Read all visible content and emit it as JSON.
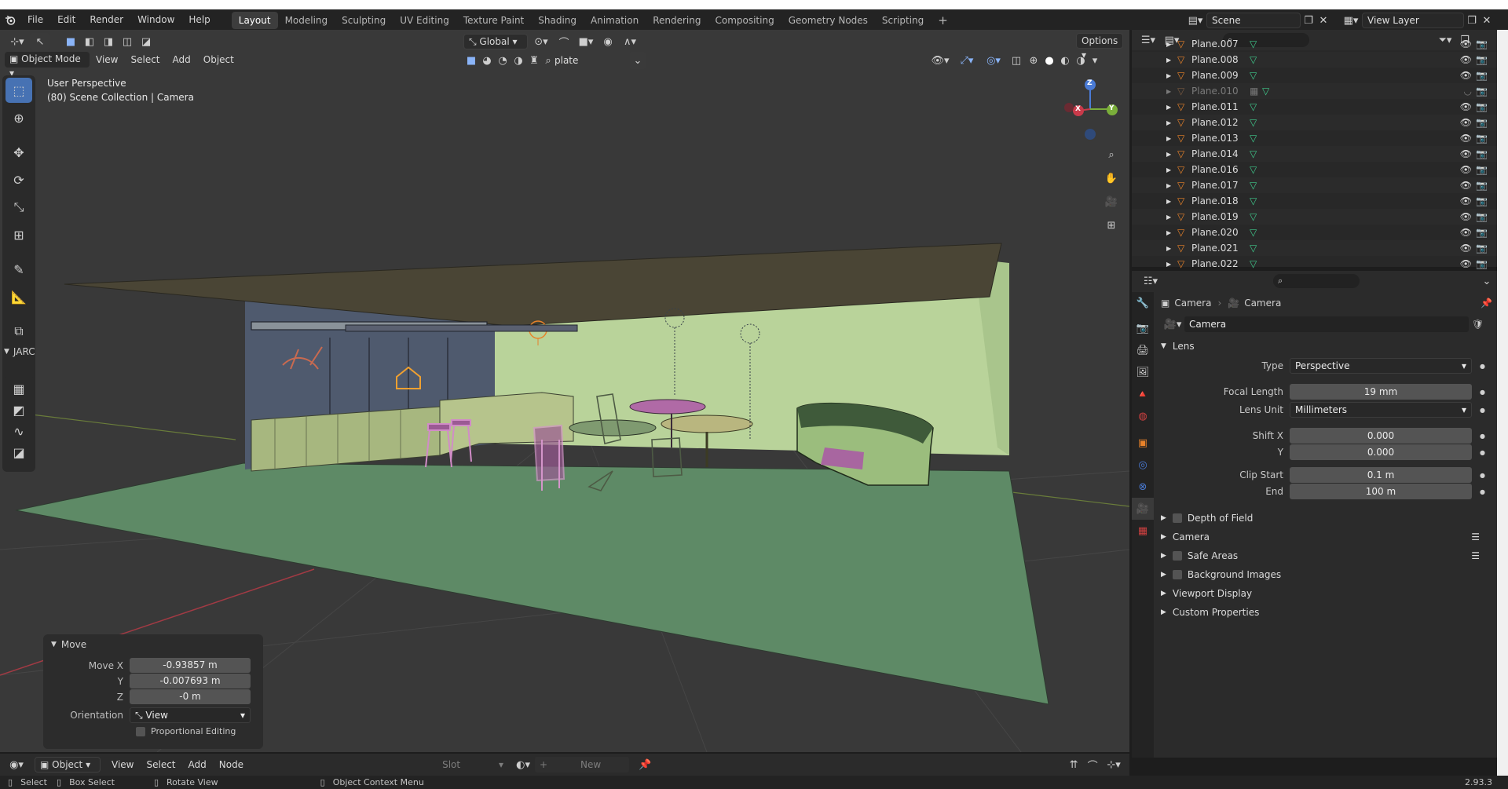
{
  "topbar": {
    "menus": [
      "File",
      "Edit",
      "Render",
      "Window",
      "Help"
    ],
    "workspace_tabs": [
      "Layout",
      "Modeling",
      "Sculpting",
      "UV Editing",
      "Texture Paint",
      "Shading",
      "Animation",
      "Rendering",
      "Compositing",
      "Geometry Nodes",
      "Scripting"
    ],
    "active_tab": "Layout",
    "scene": "Scene",
    "view_layer": "View Layer"
  },
  "viewport_header": {
    "mode": "Object Mode",
    "menus": [
      "View",
      "Select",
      "Add",
      "Object"
    ],
    "orientation": "Global",
    "search_value": "plate",
    "options_label": "Options"
  },
  "viewport": {
    "title": "User Perspective",
    "subtitle": "(80) Scene Collection | Camera",
    "gizmo": {
      "z": "Z",
      "x": "X",
      "y": "Y"
    }
  },
  "toolbar": {
    "panel_label": "JARC"
  },
  "operator_panel": {
    "title": "Move",
    "move_x_label": "Move X",
    "move_x": "-0.93857 m",
    "y_label": "Y",
    "y": "-0.007693 m",
    "z_label": "Z",
    "z": "-0 m",
    "orientation_label": "Orientation",
    "orientation": "View",
    "proportional_label": "Proportional Editing"
  },
  "outliner": {
    "items": [
      {
        "name": "Plane.007",
        "dim": false
      },
      {
        "name": "Plane.008",
        "dim": false
      },
      {
        "name": "Plane.009",
        "dim": false
      },
      {
        "name": "Plane.010",
        "dim": true
      },
      {
        "name": "Plane.011",
        "dim": false
      },
      {
        "name": "Plane.012",
        "dim": false
      },
      {
        "name": "Plane.013",
        "dim": false
      },
      {
        "name": "Plane.014",
        "dim": false
      },
      {
        "name": "Plane.016",
        "dim": false
      },
      {
        "name": "Plane.017",
        "dim": false
      },
      {
        "name": "Plane.018",
        "dim": false
      },
      {
        "name": "Plane.019",
        "dim": false
      },
      {
        "name": "Plane.020",
        "dim": false
      },
      {
        "name": "Plane.021",
        "dim": false
      },
      {
        "name": "Plane.022",
        "dim": false
      }
    ]
  },
  "properties": {
    "breadcrumb_object": "Camera",
    "breadcrumb_data": "Camera",
    "datablock_name": "Camera",
    "lens_section": "Lens",
    "type_label": "Type",
    "type_value": "Perspective",
    "focal_length_label": "Focal Length",
    "focal_length": "19 mm",
    "lens_unit_label": "Lens Unit",
    "lens_unit": "Millimeters",
    "shift_x_label": "Shift X",
    "shift_x": "0.000",
    "shift_y_label": "Y",
    "shift_y": "0.000",
    "clip_start_label": "Clip Start",
    "clip_start": "0.1 m",
    "clip_end_label": "End",
    "clip_end": "100 m",
    "sections": [
      {
        "label": "Depth of Field",
        "checkbox": true,
        "list_icon": false
      },
      {
        "label": "Camera",
        "checkbox": false,
        "list_icon": true
      },
      {
        "label": "Safe Areas",
        "checkbox": true,
        "list_icon": true
      },
      {
        "label": "Background Images",
        "checkbox": true,
        "list_icon": false
      },
      {
        "label": "Viewport Display",
        "checkbox": false,
        "list_icon": false
      },
      {
        "label": "Custom Properties",
        "checkbox": false,
        "list_icon": false
      }
    ]
  },
  "node_header": {
    "mode": "Object",
    "menus": [
      "View",
      "Select",
      "Add",
      "Node"
    ],
    "slot": "Slot",
    "new_label": "New"
  },
  "statusbar": {
    "select": "Select",
    "box_select": "Box Select",
    "rotate_view": "Rotate View",
    "context_menu": "Object Context Menu",
    "version": "2.93.3"
  },
  "colors": {
    "accent": "#4772b3",
    "floor": "#5e8a66",
    "wall": "#b9d39a",
    "roof": "#4a4535",
    "object_orange": "#e8822a",
    "mesh_green": "#3fc98b"
  }
}
